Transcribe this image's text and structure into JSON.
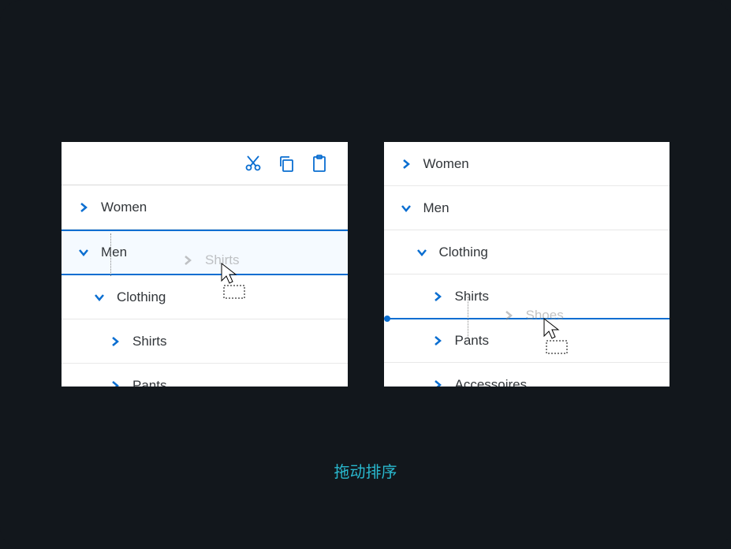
{
  "caption": "拖动排序",
  "panel_left": {
    "toolbar": {
      "cut": "cut",
      "copy": "copy",
      "paste": "paste"
    },
    "items": [
      {
        "label": "Women",
        "expanded": false
      },
      {
        "label": "Men",
        "expanded": true,
        "selected": true
      },
      {
        "label": "Clothing",
        "expanded": true
      },
      {
        "label": "Shirts",
        "expanded": false
      },
      {
        "label": "Pants",
        "expanded": false
      }
    ],
    "ghost": {
      "label": "Shirts"
    }
  },
  "panel_right": {
    "items": [
      {
        "label": "Women",
        "expanded": false
      },
      {
        "label": "Men",
        "expanded": true
      },
      {
        "label": "Clothing",
        "expanded": true
      },
      {
        "label": "Shirts",
        "expanded": false
      },
      {
        "label": "Pants",
        "expanded": false
      },
      {
        "label": "Accessoires",
        "expanded": false
      }
    ],
    "ghost": {
      "label": "Shoes"
    }
  }
}
